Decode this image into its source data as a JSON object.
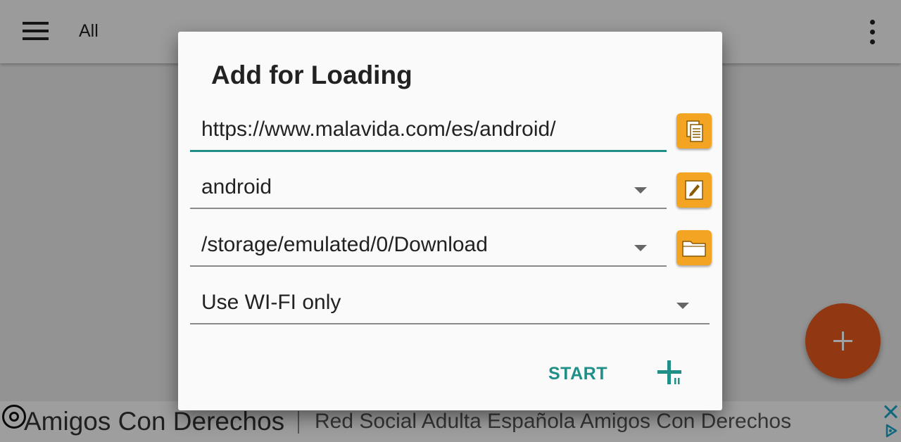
{
  "appbar": {
    "title": "All"
  },
  "ad": {
    "title": "Amigos Con Derechos",
    "description": "Red Social Adulta Española Amigos Con Derechos"
  },
  "dialog": {
    "title": "Add for Loading",
    "url_value": "https://www.malavida.com/es/android/",
    "category_value": "android",
    "folder_value": "/storage/emulated/0/Download",
    "network_value": "Use WI-FI only",
    "start_label": "START"
  },
  "colors": {
    "accent": "#1f8f87",
    "icon_button": "#f4a423",
    "fab": "#e65a1f",
    "ad_close": "#1ea3c5"
  },
  "icons": {
    "menu": "menu-icon",
    "overflow": "more-vert-icon",
    "fab": "plus-icon",
    "paste": "paste-icon",
    "edit": "pencil-icon",
    "folder": "folder-icon",
    "add_queue": "add-to-queue-icon",
    "ad_close": "close-icon",
    "ad_choices": "ad-choices-icon"
  }
}
